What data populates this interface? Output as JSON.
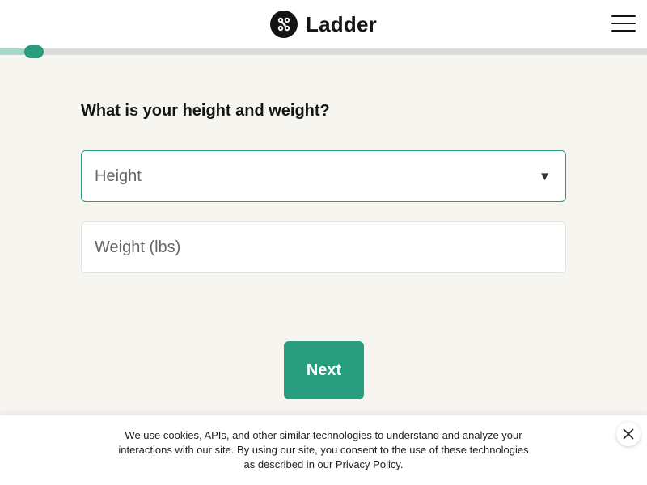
{
  "header": {
    "brand": "Ladder",
    "logo_icon": "ladder-logo-icon",
    "menu_icon": "hamburger-menu-icon"
  },
  "progress": {
    "fraction": 0.05
  },
  "form": {
    "question": "What is your height and weight?",
    "height_select": {
      "placeholder": "Height",
      "caret": "▼"
    },
    "weight_input": {
      "placeholder": "Weight (lbs)",
      "value": ""
    },
    "next_label": "Next"
  },
  "cookie_banner": {
    "text": "We use cookies, APIs, and other similar technologies to understand and analyze your interactions with our site. By using our site, you consent to the use of these technologies as described in our Privacy Policy.",
    "close_icon": "close-icon"
  },
  "colors": {
    "accent": "#2a9d7f",
    "progress_fill": "#a8d9cb",
    "background": "#f7f5f0"
  }
}
